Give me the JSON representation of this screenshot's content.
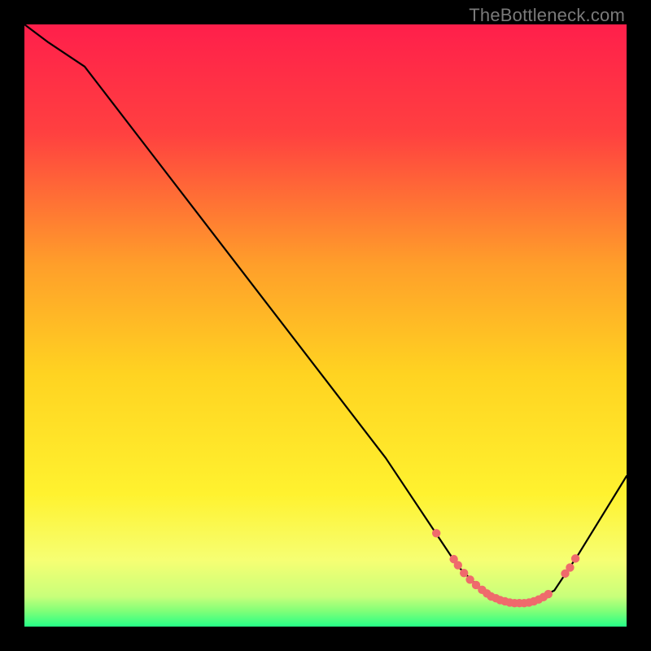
{
  "watermark": "TheBottleneck.com",
  "chart_data": {
    "type": "line",
    "title": "",
    "xlabel": "",
    "ylabel": "",
    "xlim": [
      0,
      100
    ],
    "ylim": [
      0,
      100
    ],
    "gradient_stops": [
      {
        "offset": 0.0,
        "color": "#ff1f4b"
      },
      {
        "offset": 0.18,
        "color": "#ff4040"
      },
      {
        "offset": 0.4,
        "color": "#ff9f2a"
      },
      {
        "offset": 0.58,
        "color": "#ffd321"
      },
      {
        "offset": 0.78,
        "color": "#fff22f"
      },
      {
        "offset": 0.89,
        "color": "#f6ff73"
      },
      {
        "offset": 0.95,
        "color": "#c8ff7a"
      },
      {
        "offset": 0.975,
        "color": "#7eff78"
      },
      {
        "offset": 1.0,
        "color": "#26ff87"
      }
    ],
    "series": [
      {
        "name": "bottleneck-curve",
        "x": [
          0,
          4,
          10,
          20,
          30,
          40,
          50,
          60,
          68,
          72,
          76,
          80,
          84,
          88,
          92,
          100
        ],
        "y": [
          100,
          97,
          93,
          80,
          67,
          54,
          41,
          28,
          16,
          10,
          6,
          4,
          4,
          6,
          12,
          25
        ]
      }
    ],
    "markers": {
      "name": "dots",
      "color": "#ef6a6c",
      "points": [
        {
          "x": 68.4,
          "y": 15.5
        },
        {
          "x": 71.3,
          "y": 11.2
        },
        {
          "x": 72.0,
          "y": 10.2
        },
        {
          "x": 73.0,
          "y": 8.9
        },
        {
          "x": 74.0,
          "y": 7.8
        },
        {
          "x": 75.0,
          "y": 6.9
        },
        {
          "x": 76.0,
          "y": 6.1
        },
        {
          "x": 76.8,
          "y": 5.5
        },
        {
          "x": 77.5,
          "y": 5.0
        },
        {
          "x": 78.3,
          "y": 4.7
        },
        {
          "x": 79.0,
          "y": 4.4
        },
        {
          "x": 79.8,
          "y": 4.2
        },
        {
          "x": 80.6,
          "y": 4.0
        },
        {
          "x": 81.4,
          "y": 3.9
        },
        {
          "x": 82.2,
          "y": 3.9
        },
        {
          "x": 83.0,
          "y": 3.9
        },
        {
          "x": 83.8,
          "y": 4.0
        },
        {
          "x": 84.6,
          "y": 4.2
        },
        {
          "x": 85.4,
          "y": 4.5
        },
        {
          "x": 86.2,
          "y": 4.9
        },
        {
          "x": 87.0,
          "y": 5.4
        },
        {
          "x": 89.8,
          "y": 8.8
        },
        {
          "x": 90.6,
          "y": 9.8
        },
        {
          "x": 91.5,
          "y": 11.3
        }
      ]
    }
  }
}
